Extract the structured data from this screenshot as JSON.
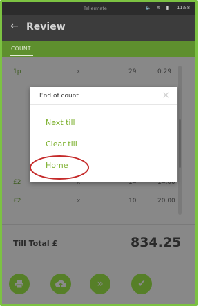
{
  "status_bar": {
    "app_name": "Tellermate",
    "icons": [
      "volume-icon",
      "wifi-icon",
      "battery-icon"
    ],
    "time": "11:58"
  },
  "header": {
    "title": "Review"
  },
  "tabs": [
    {
      "label": "COUNT"
    }
  ],
  "rows": [
    {
      "denomination": "1p",
      "x": "x",
      "quantity": "29",
      "value": "0.29"
    },
    {
      "denomination": "£2",
      "x": "x",
      "quantity": "14",
      "value": "14.00"
    },
    {
      "denomination": "£2",
      "x": "x",
      "quantity": "10",
      "value": "20.00"
    }
  ],
  "footer": {
    "total_label": "Till Total £",
    "total_value": "834.25",
    "actions": [
      "print-icon",
      "upload-icon",
      "next-icon",
      "confirm-icon"
    ]
  },
  "dialog": {
    "title": "End of count",
    "close_label": "×",
    "options": [
      "Next till",
      "Clear till",
      "Home"
    ]
  },
  "colors": {
    "accent_green": "#7cc242",
    "tab_green": "#5e8f2e",
    "option_green": "#7cb02d",
    "highlight_red": "#c52a2a"
  }
}
